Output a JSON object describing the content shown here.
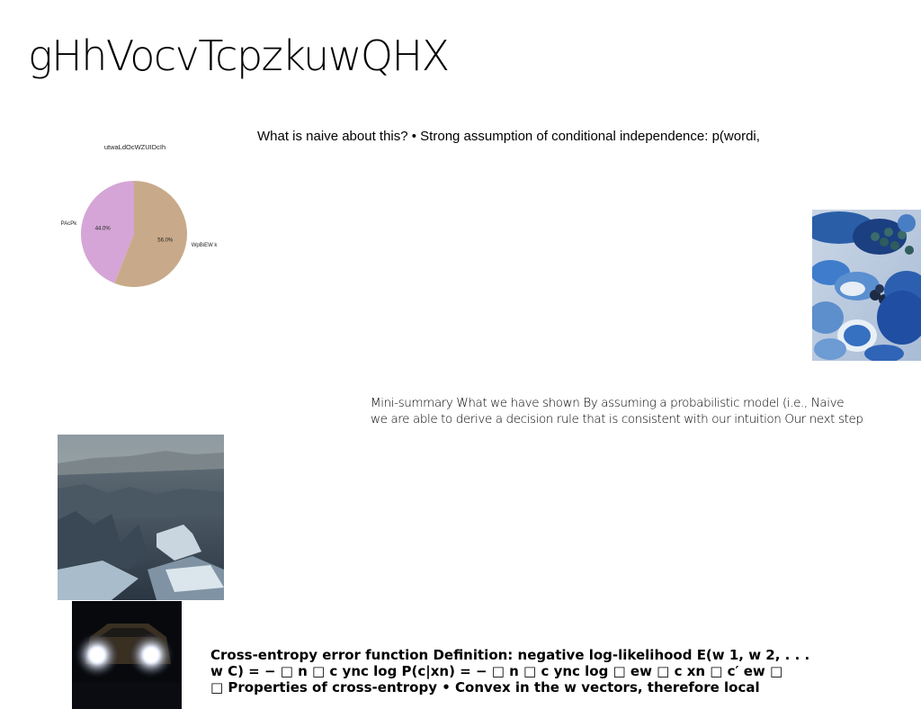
{
  "slide": {
    "title": "gHhVocvTcpzkuwQHX"
  },
  "text_naive": "What is naive about this? • Strong assumption of conditional independence: p(wordi,",
  "text_summary": {
    "line1": "Mini-summary What we have shown By assuming a probabilistic model (i.e., Naive",
    "line2": "we are able to derive a decision rule that is consistent with our intuition Our next step"
  },
  "text_crossentropy": {
    "line1": "Cross-entropy error function Definition: negative log-likelihood E(w 1, w 2, . . .",
    "line2": "w C) = − □ n □ c ync log P(c|xn) = − □ n □ c ync log □ ew □ c xn □ c′ ew □",
    "line3": "□ Properties of cross-entropy • Convex in the w vectors, therefore local"
  },
  "chart_data": {
    "type": "pie",
    "title": "utwaLdOcWZUIDcIh",
    "categories": [
      "PAcPk",
      "WpBiEW k"
    ],
    "values": [
      44.0,
      56.0
    ],
    "value_labels": [
      "44.0%",
      "56.0%"
    ],
    "colors": [
      "#d4a5d6",
      "#c8aa8a"
    ]
  },
  "images": {
    "food": "blue-food-photo",
    "landscape": "rocky-landscape-photo",
    "car": "car-headlights-photo"
  }
}
